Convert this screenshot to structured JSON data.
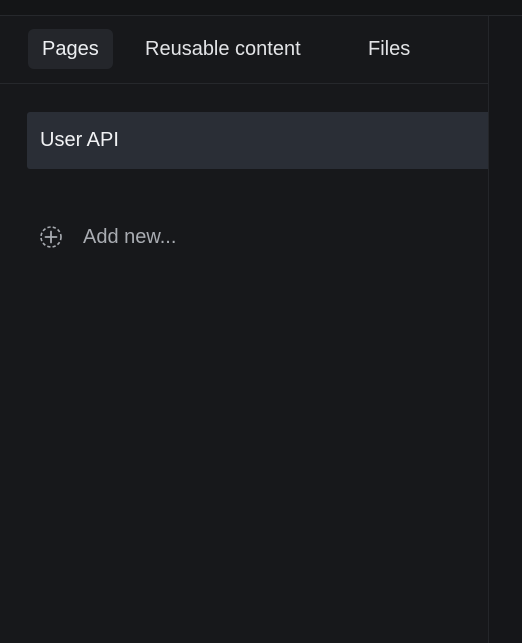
{
  "tabs": [
    {
      "label": "Pages",
      "active": true
    },
    {
      "label": "Reusable content",
      "active": false
    },
    {
      "label": "Files",
      "active": false
    }
  ],
  "pages": [
    {
      "label": "User API",
      "selected": true
    }
  ],
  "add_new": {
    "label": "Add new...",
    "icon": "add-circle-icon"
  },
  "colors": {
    "background": "#17181b",
    "selected_item": "#2a2e36",
    "active_tab": "#24262b",
    "muted_text": "#a9acb2"
  }
}
